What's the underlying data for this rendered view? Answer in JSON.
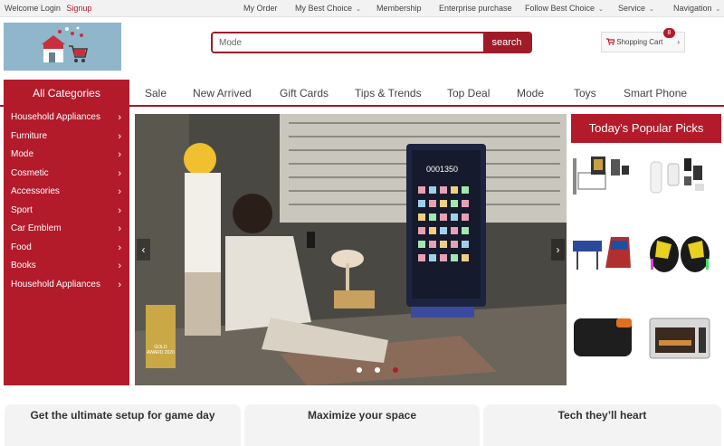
{
  "topbar": {
    "welcome": "Welcome Login",
    "signup": "Signup",
    "links": [
      "My Order",
      "My Best Choice",
      "Membership",
      "Enterprise purchase",
      "Follow Best Choice",
      "Service",
      "Navigation"
    ]
  },
  "search": {
    "value": "Mode",
    "button": "search"
  },
  "cart": {
    "label": "Shopping Cart",
    "count": "8"
  },
  "nav": {
    "all_categories": "All Categories",
    "tabs": [
      "Sale",
      "New Arrived",
      "Gift Cards",
      "Tips & Trends",
      "Top Deal",
      "Mode",
      "Toys",
      "Smart Phone"
    ]
  },
  "categories": [
    "Household Appliances",
    "Furniture",
    "Mode",
    "Cosmetic",
    "Accessories",
    "Sport",
    "Car Emblem",
    "Food",
    "Books",
    "Household Appliances"
  ],
  "hero": {
    "screen_number": "0001350",
    "award": "GOLD AWARD 2020",
    "slide_count": 3,
    "active_slide": 3
  },
  "picks": {
    "title": "Today's Popular Picks"
  },
  "sections": [
    "Get the ultimate setup for game day",
    "Maximize your space",
    "Tech they’ll heart"
  ],
  "colors": {
    "accent": "#b31b2b"
  }
}
